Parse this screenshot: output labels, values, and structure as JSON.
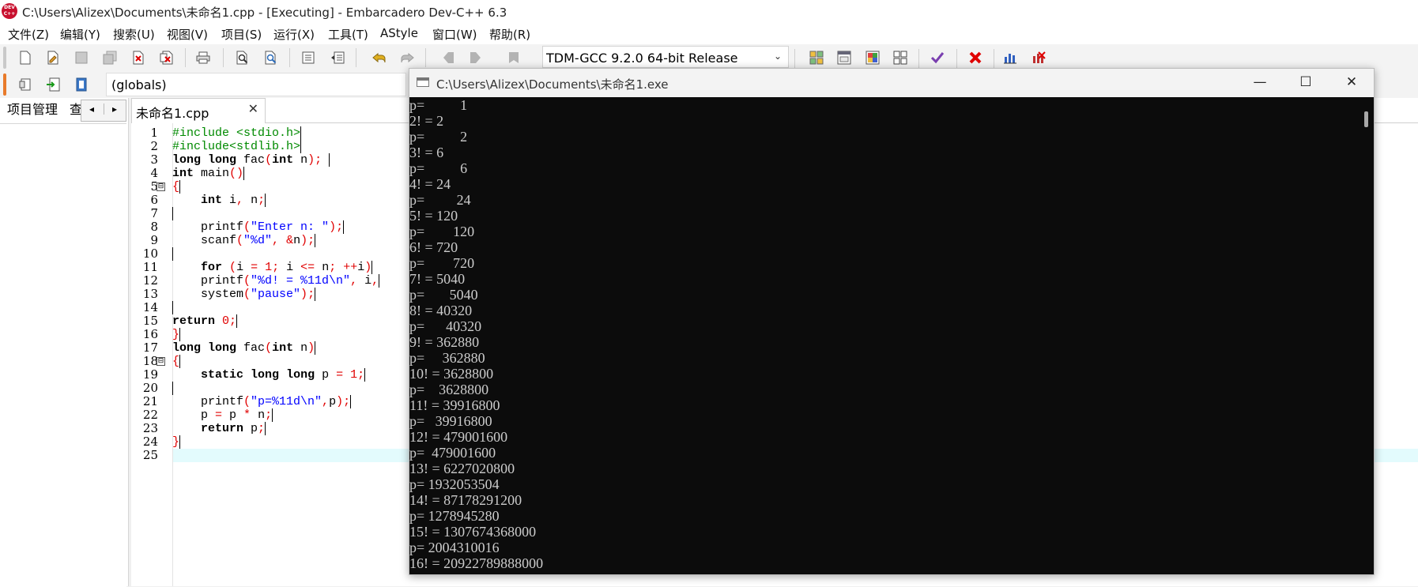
{
  "window": {
    "title": "C:\\Users\\Alizex\\Documents\\未命名1.cpp - [Executing] - Embarcadero Dev-C++ 6.3",
    "logo_text": "DEV C++"
  },
  "menu": [
    "文件(Z)",
    "编辑(Y)",
    "搜索(U)",
    "视图(V)",
    "项目(S)",
    "运行(X)",
    "工具(T)",
    "AStyle",
    "窗口(W)",
    "帮助(R)"
  ],
  "toolbar": {
    "compiler": "TDM-GCC 9.2.0 64-bit Release",
    "scope": "(globals)"
  },
  "left_panel": {
    "tab_project": "项目管理",
    "tab_cut": "查",
    "nav_prev": "◂",
    "nav_next": "▸"
  },
  "editor": {
    "file_tab": "未命名1.cpp",
    "close_glyph": "✕",
    "line_numbers": [
      "1",
      "2",
      "3",
      "4",
      "5",
      "6",
      "7",
      "8",
      "9",
      "10",
      "11",
      "12",
      "13",
      "14",
      "15",
      "16",
      "17",
      "18",
      "19",
      "20",
      "21",
      "22",
      "23",
      "24",
      "25"
    ],
    "fold_markers": [
      "⊟",
      "⊟"
    ],
    "lines": [
      "#include <stdio.h>",
      "#include<stdlib.h>",
      "long long fac(int n); ",
      "int main()",
      "{",
      "    int i, n;",
      "",
      "    printf(\"Enter n: \");",
      "    scanf(\"%d\", &n);",
      "",
      "    for (i = 1; i <= n; ++i)",
      "    printf(\"%d! = %11d\\n\", i,",
      "    system(\"pause\");",
      "",
      "return 0;",
      "}",
      "long long fac(int n)",
      "{",
      "    static long long p = 1;",
      "",
      "    printf(\"p=%11d\\n\",p);",
      "    p = p * n;",
      "    return p;",
      "}",
      ""
    ]
  },
  "console": {
    "title": "C:\\Users\\Alizex\\Documents\\未命名1.exe",
    "minimize": "—",
    "maximize": "☐",
    "close": "✕",
    "lines": [
      "p=          1",
      "2! = 2",
      "p=          2",
      "3! = 6",
      "p=          6",
      "4! = 24",
      "p=         24",
      "5! = 120",
      "p=        120",
      "6! = 720",
      "p=        720",
      "7! = 5040",
      "p=       5040",
      "8! = 40320",
      "p=      40320",
      "9! = 362880",
      "p=     362880",
      "10! = 3628800",
      "p=    3628800",
      "11! = 39916800",
      "p=   39916800",
      "12! = 479001600",
      "p=  479001600",
      "13! = 6227020800",
      "p= 1932053504",
      "14! = 87178291200",
      "p= 1278945280",
      "15! = 1307674368000",
      "p= 2004310016",
      "16! = 20922789888000"
    ]
  },
  "colors": {
    "preprocessor": "#008a00",
    "keyword": "#000000",
    "symbol": "#e00000",
    "string": "#0000ff",
    "current_line": "#e3fbfd",
    "console_bg": "#0c0c0c",
    "console_fg": "#cccccc"
  }
}
